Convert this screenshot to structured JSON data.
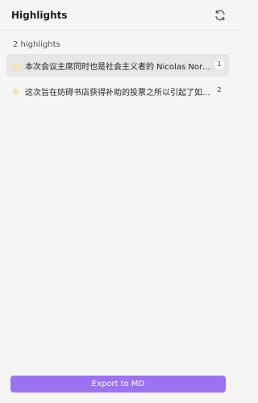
{
  "header": {
    "title": "Highlights",
    "refresh_icon": "refresh-icon"
  },
  "summary": {
    "count_text": "2 highlights"
  },
  "highlights": [
    {
      "text": "本次会议主席同时也是社会主义者的 Nicolas Nord...",
      "count": "1",
      "color": "#f6e3a1"
    },
    {
      "text": "这次旨在妨碍书店获得补助的投票之所以引起了如...",
      "count": "2",
      "color": "#f6e3a1"
    }
  ],
  "footer": {
    "export_label": "Export to MD"
  },
  "colors": {
    "accent": "#9b73f0",
    "background": "#f5f5f5",
    "highlight_dot": "#f6e3a1"
  }
}
